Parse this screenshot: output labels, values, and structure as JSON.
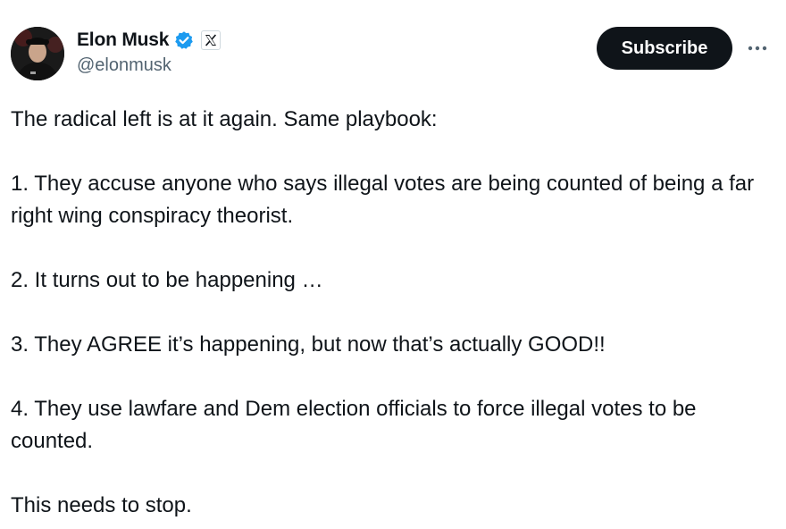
{
  "author": {
    "display_name": "Elon Musk",
    "handle": "@elonmusk",
    "verified_badge": "verified-checkmark-icon",
    "affiliate_badge": "x-logo-icon",
    "colors": {
      "verified_blue": "#1d9bf0",
      "handle_gray": "#536471"
    }
  },
  "actions": {
    "subscribe_label": "Subscribe",
    "more_icon": "more-horizontal-icon"
  },
  "tweet": {
    "paragraphs": [
      "The radical left is at it again. Same playbook:",
      "1. They accuse anyone who says illegal votes are being counted of being a far right wing conspiracy theorist.",
      "2. It turns out to be happening …",
      "3. They AGREE it’s happening, but now that’s actually GOOD!!",
      "4. They use lawfare and Dem election officials to force illegal votes to be counted.",
      "This needs to stop."
    ]
  },
  "theme": {
    "button_bg": "#0f1419",
    "button_text": "#ffffff",
    "text": "#0f1419"
  }
}
